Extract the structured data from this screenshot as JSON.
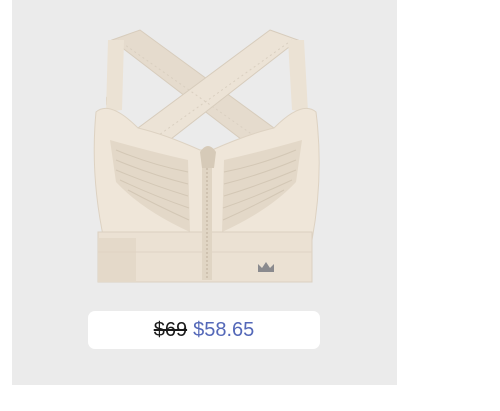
{
  "product": {
    "image": "beige-zip-front-sports-bra",
    "logo_icon": "crown-icon",
    "original_price": "$69",
    "sale_price": "$58.65"
  },
  "colors": {
    "card_background": "#ebebeb",
    "fabric": "#eee5d8",
    "sale_price": "#5468b8",
    "original_price": "#1a1a1a"
  }
}
